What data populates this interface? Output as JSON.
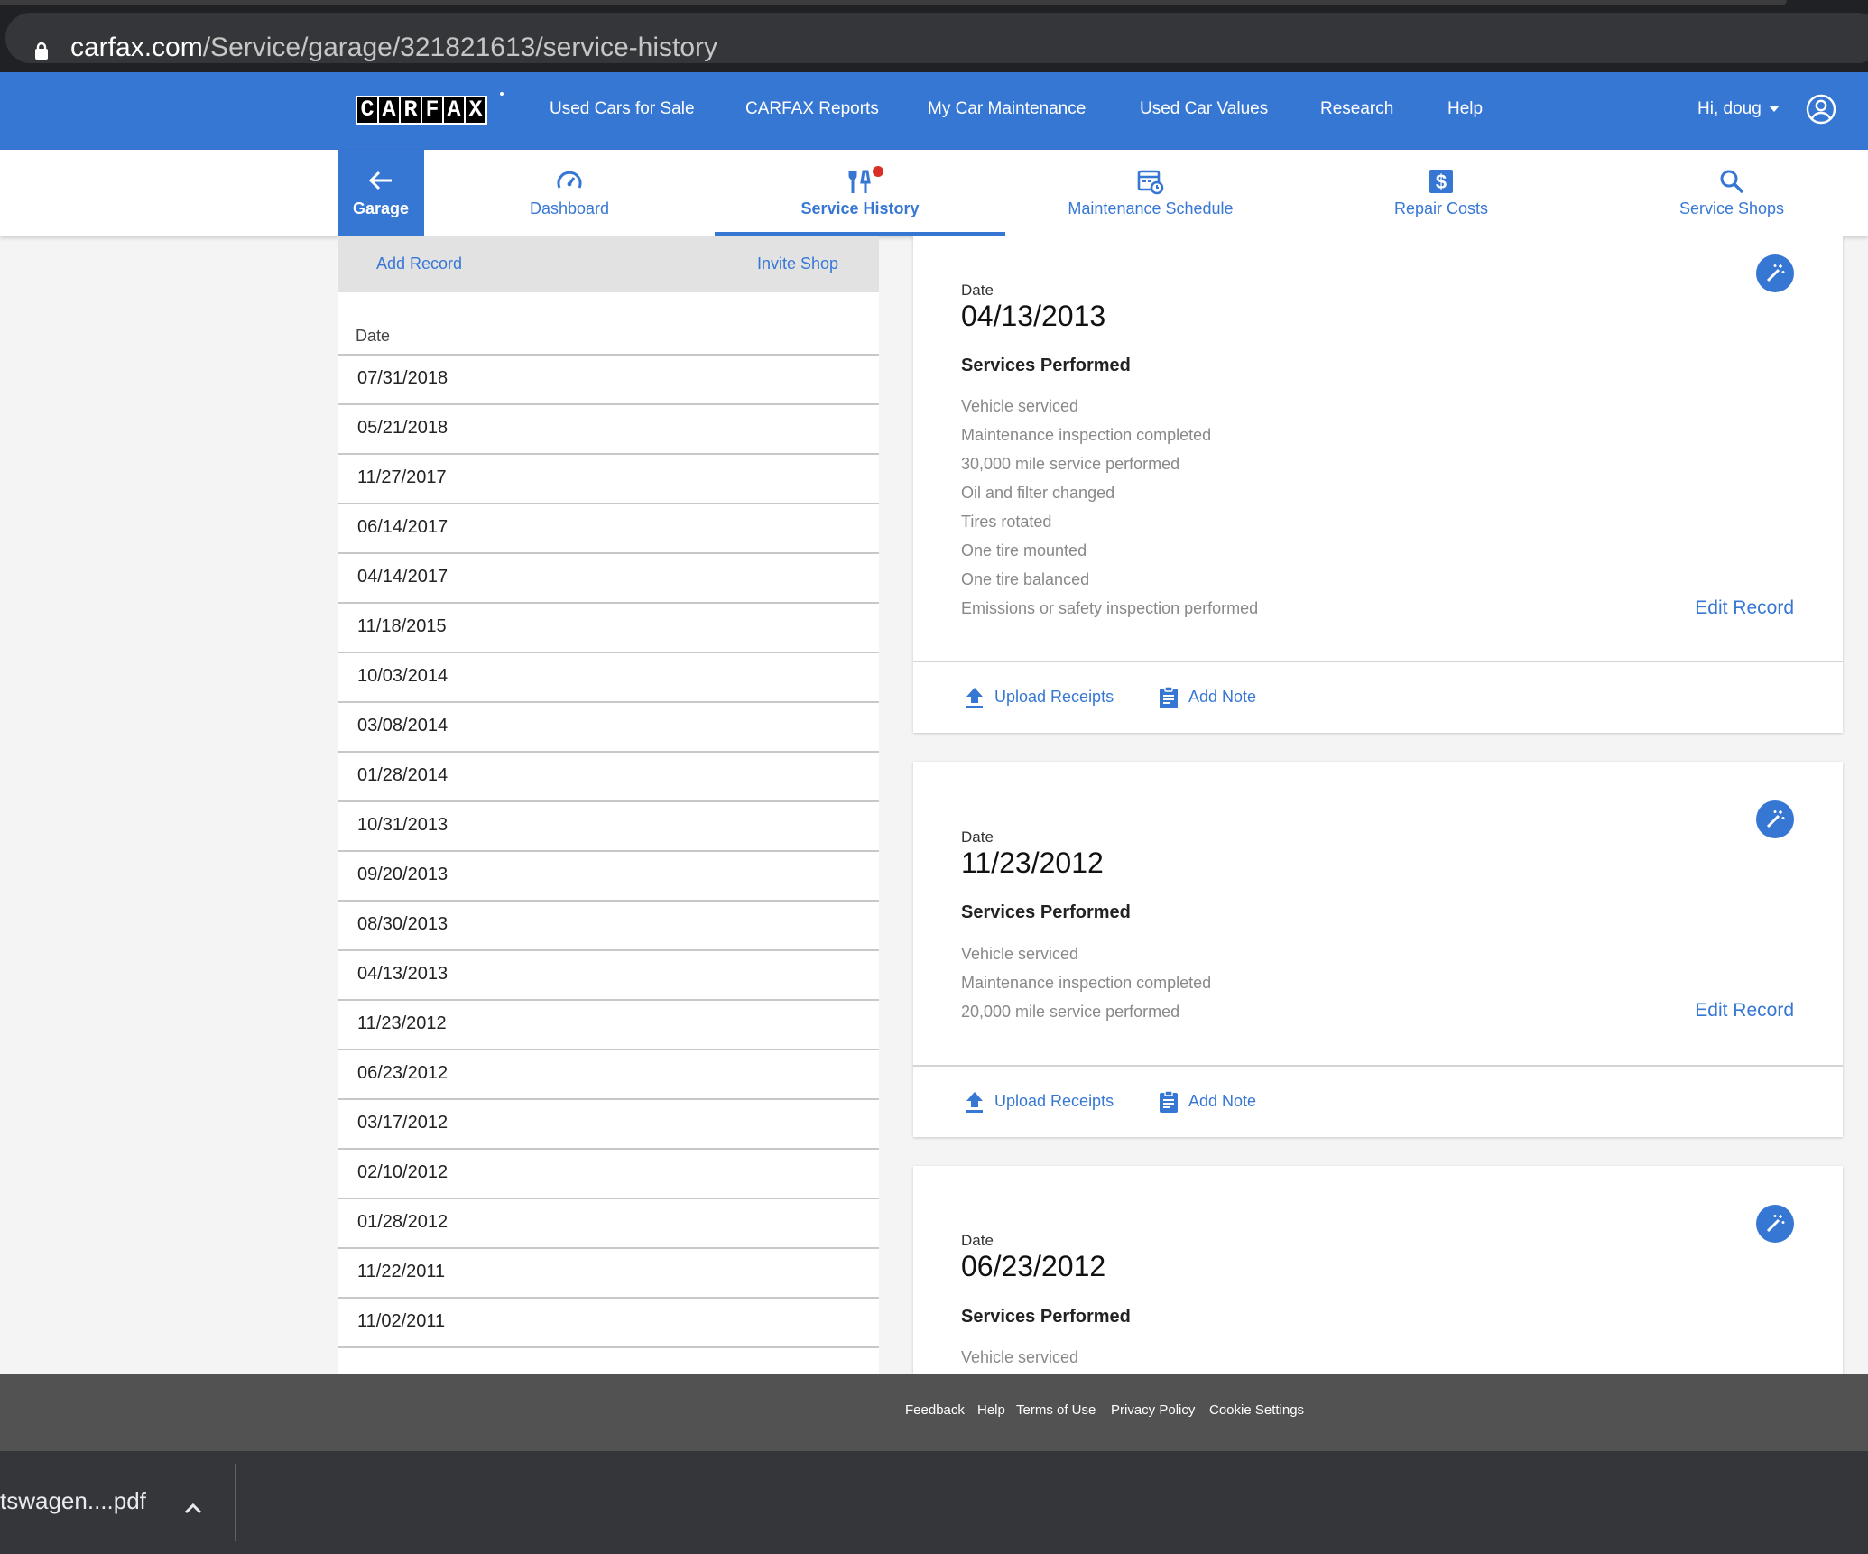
{
  "browser": {
    "url_host": "carfax.com",
    "url_path": "/Service/garage/321821613/service-history"
  },
  "header": {
    "logo_letters": [
      "C",
      "A",
      "R",
      "F",
      "A",
      "X"
    ],
    "nav": [
      "Used Cars for Sale",
      "CARFAX Reports",
      "My Car Maintenance",
      "Used Car Values",
      "Research",
      "Help"
    ],
    "user_greeting": "Hi, doug"
  },
  "tabs": {
    "back_label": "Garage",
    "items": [
      {
        "label": "Dashboard",
        "icon": "speedometer-icon"
      },
      {
        "label": "Service History",
        "icon": "tools-icon",
        "active": true
      },
      {
        "label": "Maintenance Schedule",
        "icon": "calendar-clock-icon"
      },
      {
        "label": "Repair Costs",
        "icon": "dollar-icon"
      },
      {
        "label": "Service Shops",
        "icon": "search-icon"
      }
    ]
  },
  "list": {
    "add_record": "Add Record",
    "invite_shop": "Invite Shop",
    "column_header": "Date",
    "dates": [
      "07/31/2018",
      "05/21/2018",
      "11/27/2017",
      "06/14/2017",
      "04/14/2017",
      "11/18/2015",
      "10/03/2014",
      "03/08/2014",
      "01/28/2014",
      "10/31/2013",
      "09/20/2013",
      "08/30/2013",
      "04/13/2013",
      "11/23/2012",
      "06/23/2012",
      "03/17/2012",
      "02/10/2012",
      "01/28/2012",
      "11/22/2011",
      "11/02/2011"
    ]
  },
  "records": [
    {
      "date_label": "Date",
      "date": "04/13/2013",
      "services_title": "Services Performed",
      "services": [
        "Vehicle serviced",
        "Maintenance inspection completed",
        "30,000 mile service performed",
        "Oil and filter changed",
        "Tires rotated",
        "One tire mounted",
        "One tire balanced",
        "Emissions or safety inspection performed"
      ],
      "edit_label": "Edit Record",
      "upload_label": "Upload Receipts",
      "note_label": "Add Note"
    },
    {
      "date_label": "Date",
      "date": "11/23/2012",
      "services_title": "Services Performed",
      "services": [
        "Vehicle serviced",
        "Maintenance inspection completed",
        "20,000 mile service performed"
      ],
      "edit_label": "Edit Record",
      "upload_label": "Upload Receipts",
      "note_label": "Add Note"
    },
    {
      "date_label": "Date",
      "date": "06/23/2012",
      "services_title": "Services Performed",
      "services": [
        "Vehicle serviced"
      ]
    }
  ],
  "footer": {
    "links": [
      "Feedback",
      "Help",
      "Terms of Use",
      "Privacy Policy",
      "Cookie Settings"
    ]
  },
  "download": {
    "filename": "tswagen....pdf"
  },
  "colors": {
    "brand_blue": "#3777d4",
    "notification": "#d93025"
  }
}
